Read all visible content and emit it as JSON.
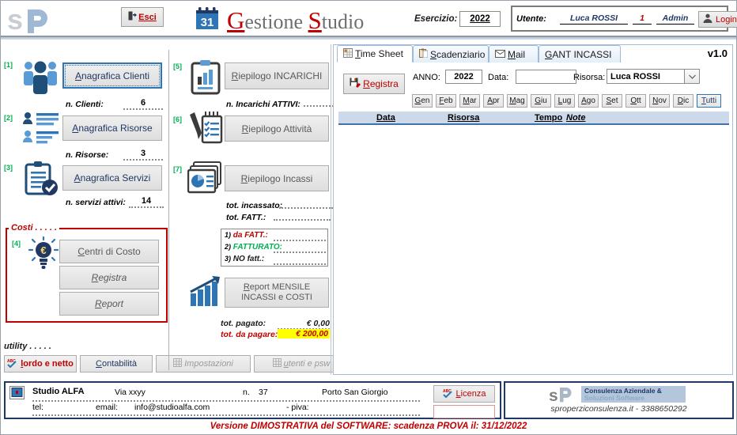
{
  "header": {
    "logo": "sp-logo",
    "exit_button": {
      "label": "Esci",
      "icon": "exit-door-icon"
    },
    "calendar_icon": "calendar-31-icon",
    "title_part1_cap": "G",
    "title_part1_rest": "estione",
    "title_part2_cap": "S",
    "title_part2_rest": "tudio",
    "esercizio_label": "Esercizio:",
    "esercizio_value": "2022",
    "user_label": "Utente:",
    "user_name": "Luca ROSSI",
    "user_number": "1",
    "user_role": "Admin",
    "login_button": "Login",
    "login_icon": "user-avatar-icon"
  },
  "left": {
    "tags": {
      "t1": "[1]",
      "t2": "[2]",
      "t3": "[3]",
      "t4": "[4]",
      "t5": "[5]",
      "t6": "[6]",
      "t7": "[7]"
    },
    "btn_clienti_u": "A",
    "btn_clienti_rest": "nagrafica Clienti",
    "btn_risorse_u": "A",
    "btn_risorse_rest": "nagrafica Risorse",
    "btn_servizi_u": "A",
    "btn_servizi_rest": "nagrafica Servizi",
    "lbl_clienti": "n. Clienti:",
    "val_clienti": "6",
    "lbl_risorse": "n. Risorse:",
    "val_risorse": "3",
    "lbl_servizi": "n. servizi attivi:",
    "val_servizi": "14",
    "icon_clienti": "group-people-icon",
    "icon_risorse": "contact-list-icon",
    "icon_servizi": "clipboard-check-icon"
  },
  "costi": {
    "legend": "Costi . . . . .",
    "icon": "euro-lightbulb-icon",
    "btn_centri_u": "C",
    "btn_centri_rest": "entri di Costo",
    "btn_registra_u": "R",
    "btn_registra_rest": "egistra",
    "btn_report_u": "R",
    "btn_report_rest": "eport"
  },
  "utility": {
    "label": "utility . . . . .",
    "btn_lordo_u": "l",
    "btn_lordo_rest": "ordo e netto",
    "btn_lordo_icon": "abc-check-icon",
    "btn_contabilita_u": "C",
    "btn_contabilita_rest": "ontabilità",
    "btn_impostazioni_u": "I",
    "btn_impostazioni_rest": "mpostazioni",
    "btn_impostazioni_icon": "grid-icon",
    "btn_utenti_u": "u",
    "btn_utenti_rest": "tenti e psw",
    "btn_utenti_icon": "grid-icon"
  },
  "middle": {
    "btn_incarichi_u": "R",
    "btn_incarichi_rest": "iepilogo INCARICHI",
    "btn_attivita_u": "R",
    "btn_attivita_rest": "iepilogo Attività",
    "btn_incassi_u": "R",
    "btn_incassi_rest": "iepilogo Incassi",
    "lbl_incarichi_attivi": "n. Incarichi ATTIVI:",
    "val_incarichi_attivi": "",
    "lbl_tot_incassato": "tot. incassato:",
    "val_tot_incassato": "",
    "lbl_tot_fatt": "tot. FATT.:",
    "val_tot_fatt": "",
    "fatt_rows": [
      {
        "num": "1)",
        "label": "da FATT.:",
        "color": "#c00000",
        "value": ""
      },
      {
        "num": "2)",
        "label": "FATTURATO:",
        "color": "#00b050",
        "value": ""
      },
      {
        "num": "3)",
        "label": "NO fatt.:",
        "color": "#1a1a1a",
        "value": ""
      }
    ],
    "btn_report_mensile_u": "R",
    "btn_report_mensile_rest": "eport MENSILE INCASSI e COSTI",
    "lbl_tot_pagato": "tot. pagato:",
    "val_tot_pagato": "€ 0,00",
    "lbl_tot_da_pagare": "tot. da pagare:",
    "val_tot_da_pagare": "€ 200,00",
    "icon_incarichi": "clipboard-barchart-icon",
    "icon_attivita": "notepad-pen-icon",
    "icon_incassi": "piechart-docs-icon",
    "icon_report": "bar-growth-icon"
  },
  "right": {
    "tabs": [
      {
        "label_u": "T",
        "label_rest": "ime Sheet",
        "icon": "grid-table-icon",
        "active": true
      },
      {
        "label_u": "S",
        "label_rest": "cadenziario",
        "icon": "clipboard-icon",
        "active": false
      },
      {
        "label_u": "M",
        "label_rest": "ail",
        "icon": "envelope-icon",
        "active": false
      },
      {
        "label_u": "G",
        "label_rest": "ANT INCASSI",
        "icon": "",
        "active": false
      }
    ],
    "version": "v1.0",
    "btn_registra_u": "R",
    "btn_registra_rest": "egistra",
    "btn_registra_icon": "save-pen-icon",
    "anno_label": "ANNO:",
    "anno_value": "2022",
    "data_label": "Data:",
    "data_value": "",
    "data_placeholder": "",
    "risorsa_label": "Risorsa:",
    "risorsa_value": "Luca ROSSI",
    "months": [
      {
        "u": "G",
        "rest": "en"
      },
      {
        "u": "F",
        "rest": "eb"
      },
      {
        "u": "M",
        "rest": "ar"
      },
      {
        "u": "A",
        "rest": "pr"
      },
      {
        "u": "M",
        "rest": "ag"
      },
      {
        "u": "G",
        "rest": "iu"
      },
      {
        "u": "L",
        "rest": "ug"
      },
      {
        "u": "A",
        "rest": "go"
      },
      {
        "u": "S",
        "rest": "et"
      },
      {
        "u": "O",
        "rest": "tt"
      },
      {
        "u": "N",
        "rest": "ov"
      },
      {
        "u": "D",
        "rest": "ic"
      },
      {
        "u": "T",
        "rest": "utti"
      }
    ],
    "grid_headers": [
      {
        "label": "Data",
        "italic": false
      },
      {
        "label": "Risorsa",
        "italic": false
      },
      {
        "label": "Tempo",
        "italic": false
      },
      {
        "label": "Note",
        "italic": true
      }
    ]
  },
  "footer": {
    "icon": "window-small-icon",
    "studio_name": "Studio ALFA",
    "via": "Via xxyy",
    "n_label": "n.",
    "n_value": "37",
    "city": "Porto San Giorgio",
    "tel_label": "tel:",
    "tel_value": "",
    "email_label": "email:",
    "email_value": "info@studioalfa.com",
    "piva_label": "- piva:",
    "piva_value": "",
    "licenza_button": "icenza",
    "licenza_button_u": "L",
    "licenza_icon": "abc-check-icon",
    "licenza_input": "",
    "brand_logo": "sp-logo",
    "brand_line1": "Consulenza Aziendale &",
    "brand_line2": "Soluzioni Software",
    "brand_site": "sproperziconsulenza.it - 3388650292",
    "demo_note": "Versione DIMOSTRATIVA del SOFTWARE: scadenza PROVA il: 31/12/2022"
  },
  "colors": {
    "accent_red": "#c00000",
    "accent_blue": "#1f3864",
    "tag_green": "#00b050",
    "highlight_yellow": "#ffff00",
    "grid_header": "#ccd9ea"
  }
}
